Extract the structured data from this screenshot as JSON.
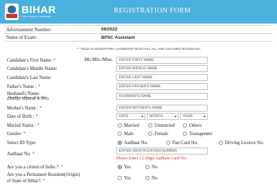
{
  "header": {
    "logo_text": "BIHAR",
    "logo_subtitle": "Public Service Commission",
    "title": "REGISTRATION FORM"
  },
  "info": {
    "advertisement_label": "Advetisement Number:",
    "advertisement_value": "06/2022",
    "exam_label": "Name of Exam:",
    "exam_value": "BPSC Assistant"
  },
  "notice": {
    "star": "\"*\"",
    "text": " FIELD IS MANDATORY. CANDIDATE MUST FILL ALL THE COLUMNS IN ENGLISH."
  },
  "form": {
    "first_name_label": "Candidate's First Name:",
    "salutation": "Mr./Mrs./Miss.",
    "first_name_placeholder": "ENTER FIRST NAME",
    "middle_name_label": "Candidate's Middle Name:",
    "middle_name_placeholder": "ENTER MIDDLE NAME",
    "last_name_label": "Candidate's Last Name:",
    "last_name_placeholder": "ENTER LAST NAME",
    "father_label": "Father's Name :",
    "father_placeholder": "ENTER FATHER'S NAME",
    "husband_label": "Husband's Name:",
    "husband_label_hindi": "(विवाहित महिलाओं के लिए)",
    "husband_placeholder": "HUSBAND'S NAME",
    "mother_label": "Mother's Name :",
    "mother_placeholder": "ENTER MOTHER'S NAME",
    "dob_label": "Date of Birth :",
    "dob_date": "DATE",
    "dob_month": "MONTH",
    "dob_year": "YEAR",
    "marital_label": "Marital Status :",
    "marital_options": [
      "Married",
      "Unmarried",
      "Others"
    ],
    "gender_label": "Gender:",
    "gender_options": [
      "Male",
      "Female",
      "Transgender"
    ],
    "id_type_label": "Select ID Type:",
    "id_options": [
      "Aadhaar No.",
      "Pan Card No.",
      "Driving Licence No."
    ],
    "aadhaar_label": "Aadhaar No.",
    "aadhaar_placeholder": "ENTER IDENTIFICATION NUMBER",
    "aadhaar_error": "Please Enter 12 Digit Aadhaar Card No.",
    "citizen_label": "Are you a citizen of India ?:",
    "citizen_options": [
      "Yes",
      "No"
    ],
    "resident_label_1": "Are you a Permanent Resident(Origin)",
    "resident_label_2": "of State of Bihar?:",
    "resident_options": [
      "Yes",
      "No"
    ],
    "required_star": "*"
  }
}
